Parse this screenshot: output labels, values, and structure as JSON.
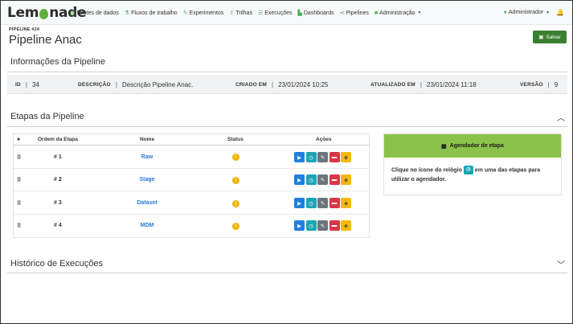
{
  "navbar": {
    "logo": {
      "pre": "Lem",
      "post": "nade"
    },
    "items": [
      {
        "label": "Fontes de dados",
        "icon": "database-icon",
        "glyph": "▤"
      },
      {
        "label": "Fluxos de trabalho",
        "icon": "flask-icon",
        "glyph": "⚗"
      },
      {
        "label": "Experimentos",
        "icon": "wand-icon",
        "glyph": "✎"
      },
      {
        "label": "Trilhas",
        "icon": "upload-icon",
        "glyph": "⇧"
      },
      {
        "label": "Execuções",
        "icon": "list-icon",
        "glyph": "☰"
      },
      {
        "label": "Dashboards",
        "icon": "chart-icon",
        "glyph": "▙"
      },
      {
        "label": "Pipelines",
        "icon": "share-icon",
        "glyph": "⋖"
      },
      {
        "label": "Administração",
        "icon": "lock-icon",
        "glyph": "🔒"
      }
    ],
    "user": "Administrador"
  },
  "header": {
    "pipeline_id": "PIPELINE #24",
    "title": "Pipeline Anac",
    "save_label": "Salvar"
  },
  "info": {
    "title": "Informações da Pipeline",
    "id_label": "ID",
    "id_value": "34",
    "desc_label": "DESCRIÇÃO",
    "desc_value": "Descrição Pipeline Anac.",
    "created_label": "CRIADO EM",
    "created_value": "23/01/2024 10:25",
    "updated_label": "ATUALIZADO EM",
    "updated_value": "23/01/2024 11:18",
    "version_label": "VERSÃO",
    "version_value": "9"
  },
  "stages": {
    "title": "Etapas da Pipeline",
    "columns": {
      "order": "Ordem da Etapa",
      "name": "Nome",
      "status": "Status",
      "actions": "Ações"
    },
    "rows": [
      {
        "order": "# 1",
        "name": "Raw",
        "status": "!"
      },
      {
        "order": "# 2",
        "name": "Stage",
        "status": "!"
      },
      {
        "order": "# 3",
        "name": "Dataset",
        "status": "!"
      },
      {
        "order": "# 4",
        "name": "MDM",
        "status": "!"
      }
    ]
  },
  "scheduler": {
    "title": "Agendador de etapa",
    "text_before": "Clique no ícone do relógio",
    "text_after": "em uma das etapas para utilizar o agendador."
  },
  "history": {
    "title": "Histórico de Execuções"
  },
  "colors": {
    "accent_green": "#3a7f32",
    "scheduler_header": "#8bc34a",
    "link_blue": "#2a7bd8",
    "status_warning": "#f0b400"
  }
}
